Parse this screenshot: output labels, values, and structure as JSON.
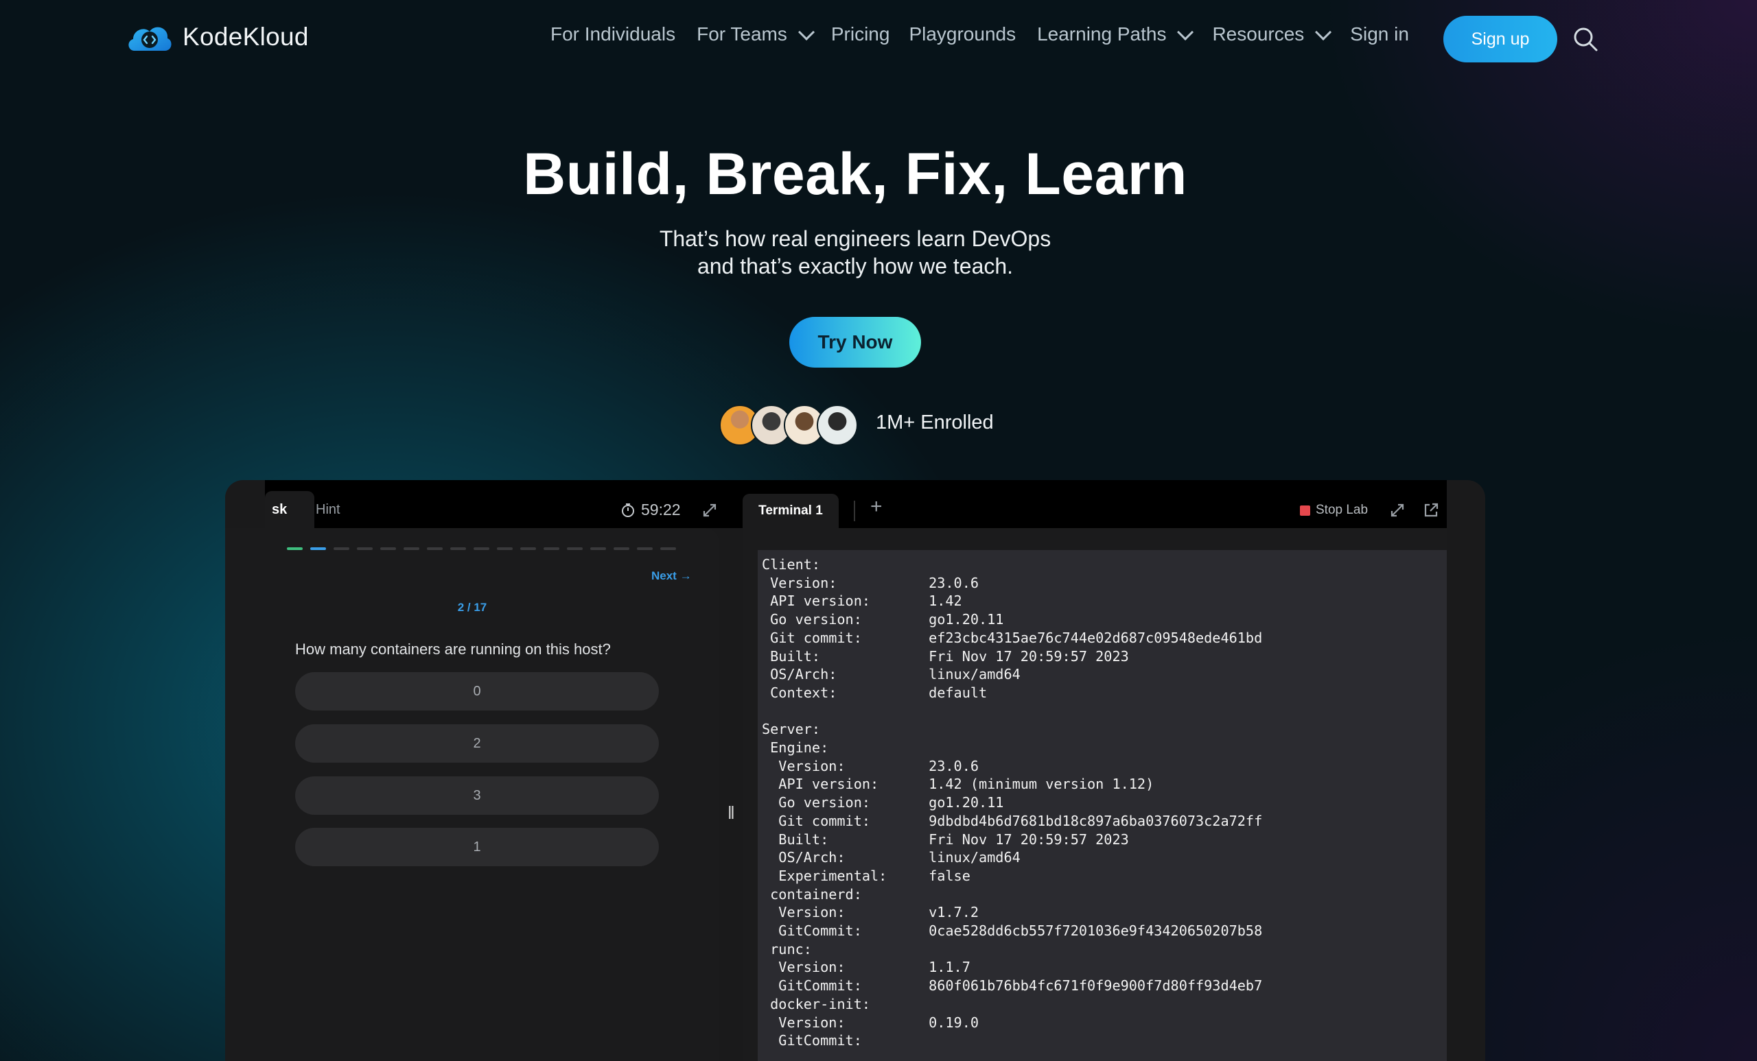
{
  "brand": {
    "name": "KodeKloud"
  },
  "nav": {
    "items": [
      {
        "label": "For Individuals",
        "dropdown": false
      },
      {
        "label": "For Teams",
        "dropdown": true
      },
      {
        "label": "Pricing",
        "dropdown": false
      },
      {
        "label": "Playgrounds",
        "dropdown": false
      },
      {
        "label": "Learning Paths",
        "dropdown": true
      },
      {
        "label": "Resources",
        "dropdown": true
      },
      {
        "label": "Sign in",
        "dropdown": false
      }
    ],
    "signup_label": "Sign up",
    "search_icon": "search-icon"
  },
  "hero": {
    "title": "Build, Break, Fix, Learn",
    "subtitle_line1": "That’s how real engineers learn DevOps",
    "subtitle_line2": "and that’s exactly how we teach.",
    "cta_label": "Try Now",
    "enrolled_label": "1M+ Enrolled"
  },
  "lab": {
    "tabs": {
      "task": "sk",
      "hint": "Hint"
    },
    "timer": "59:22",
    "progress": {
      "done": 1,
      "current": 2,
      "total": 17
    },
    "next_label": "Next",
    "step_label": "2 / 17",
    "question": "How many containers are running on this host?",
    "answers": [
      "0",
      "2",
      "3",
      "1"
    ],
    "terminal_tab": "Terminal 1",
    "add_tab_label": "+",
    "stop_label": "Stop Lab",
    "terminal_output": "Client:\n Version:           23.0.6\n API version:       1.42\n Go version:        go1.20.11\n Git commit:        ef23cbc4315ae76c744e02d687c09548ede461bd\n Built:             Fri Nov 17 20:59:57 2023\n OS/Arch:           linux/amd64\n Context:           default\n\nServer:\n Engine:\n  Version:          23.0.6\n  API version:      1.42 (minimum version 1.12)\n  Go version:       go1.20.11\n  Git commit:       9dbdbd4b6d7681bd18c897a6ba0376073c2a72ff\n  Built:            Fri Nov 17 20:59:57 2023\n  OS/Arch:          linux/amd64\n  Experimental:     false\n containerd:\n  Version:          v1.7.2\n  GitCommit:        0cae528dd6cb557f7201036e9f43420650207b58\n runc:\n  Version:          1.1.7\n  GitCommit:        860f061b76bb4fc671f0f9e900f7d80ff93d4eb7\n docker-init:\n  Version:          0.19.0\n  GitCommit:"
  },
  "colors": {
    "accent_blue": "#1d9ae6",
    "cta_gradient_end": "#5ff0d9",
    "progress_done": "#3fbf7f",
    "progress_current": "#3a9ee8",
    "stop_red": "#e5484d"
  }
}
